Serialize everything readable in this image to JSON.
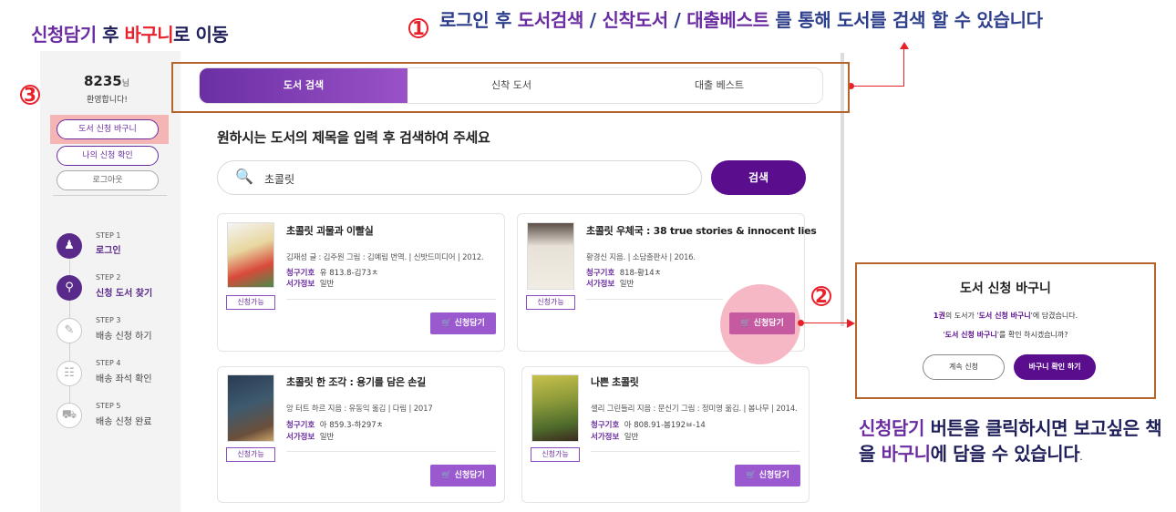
{
  "annotations": {
    "step3_title": {
      "part1": "신청담기",
      "part2": " 후 ",
      "part3": "바구니",
      "part4": "로 이동"
    },
    "num1": "1",
    "num2": "2",
    "num3": "3",
    "step1_text": {
      "part1": "로그인 후 ",
      "part2": "도서검색",
      "part3": " / ",
      "part4": "신착도서",
      "part5": " / ",
      "part6": "대출베스트",
      "part7": " 를 통해 도서를 검색 할 수 있습니다"
    },
    "step2_text": {
      "part1": "신청담기",
      "part2": " 버튼을 클릭하시면 보고싶은 책을 ",
      "part3": "바구니",
      "part4": "에 담을 수 있습니다",
      "part5": "."
    }
  },
  "user": {
    "id": "8235",
    "suffix": "님",
    "welcome": "환영합니다!"
  },
  "sidebar_buttons": {
    "basket": "도서 신청 바구니",
    "my_requests": "나의 신청 확인",
    "logout": "로그아웃"
  },
  "steps": [
    {
      "no": "STEP 1",
      "name": "로그인"
    },
    {
      "no": "STEP 2",
      "name": "신청 도서 찾기"
    },
    {
      "no": "STEP 3",
      "name": "배송 신청 하기"
    },
    {
      "no": "STEP 4",
      "name": "배송 좌석 확인"
    },
    {
      "no": "STEP 5",
      "name": "배송 신청 완료"
    }
  ],
  "tabs": [
    "도서 검색",
    "신착 도서",
    "대출 베스트"
  ],
  "search": {
    "heading": "원하시는 도서의 제목을 입력 후 검색하여 주세요",
    "value": "초콜릿",
    "button": "검색"
  },
  "labels": {
    "call_no": "청구기호",
    "location": "서가정보",
    "available": "신청가능",
    "add_to_basket": "신청담기"
  },
  "books": [
    {
      "title": "초콜릿 괴물과 이빨실",
      "author": "김재성 글 : 김주원 그림 : 김예림 번역. | 신밧드미디어 | 2012.",
      "call_no": "유 813.8-김73ㅊ",
      "location": "일반"
    },
    {
      "title": "초콜릿 우체국 : 38 true stories & innocent lies",
      "author": "황경신 지음. | 소담출판사 | 2016.",
      "call_no": "818-황14ㅊ",
      "location": "일반"
    },
    {
      "title": "초콜릿 한 조각 : 용기를 담은 손길",
      "author": "앙 터트 하르 지음 : 유동익 옮김 | 다림 | 2017",
      "call_no": "아 859.3-하297ㅊ",
      "location": "일반"
    },
    {
      "title": "나쁜 초콜릿",
      "author": "샐리 그린들리 지음 : 문신기 그림 : 정미영 옮김. | 봄나무 | 2014.",
      "call_no": "아 808.91-봄192ㅂ-14",
      "location": "일반"
    }
  ],
  "dialog": {
    "title": "도서 신청 바구니",
    "line1": {
      "pre": "1권",
      "mid1": "의 도서가 '",
      "bold": "도서 신청 바구니",
      "post": "'에 담겼습니다."
    },
    "line2": {
      "pre": "'",
      "bold": "도서 신청 바구니",
      "post": "'를 확인 하시겠습니까?"
    },
    "continue": "계속 신청",
    "check": "바구니 확인 하기"
  },
  "colors": {
    "brand": "#5a0e8e",
    "accent": "#9b59cf",
    "annotation_red": "#e8202a",
    "annotation_box": "#b5652c"
  }
}
